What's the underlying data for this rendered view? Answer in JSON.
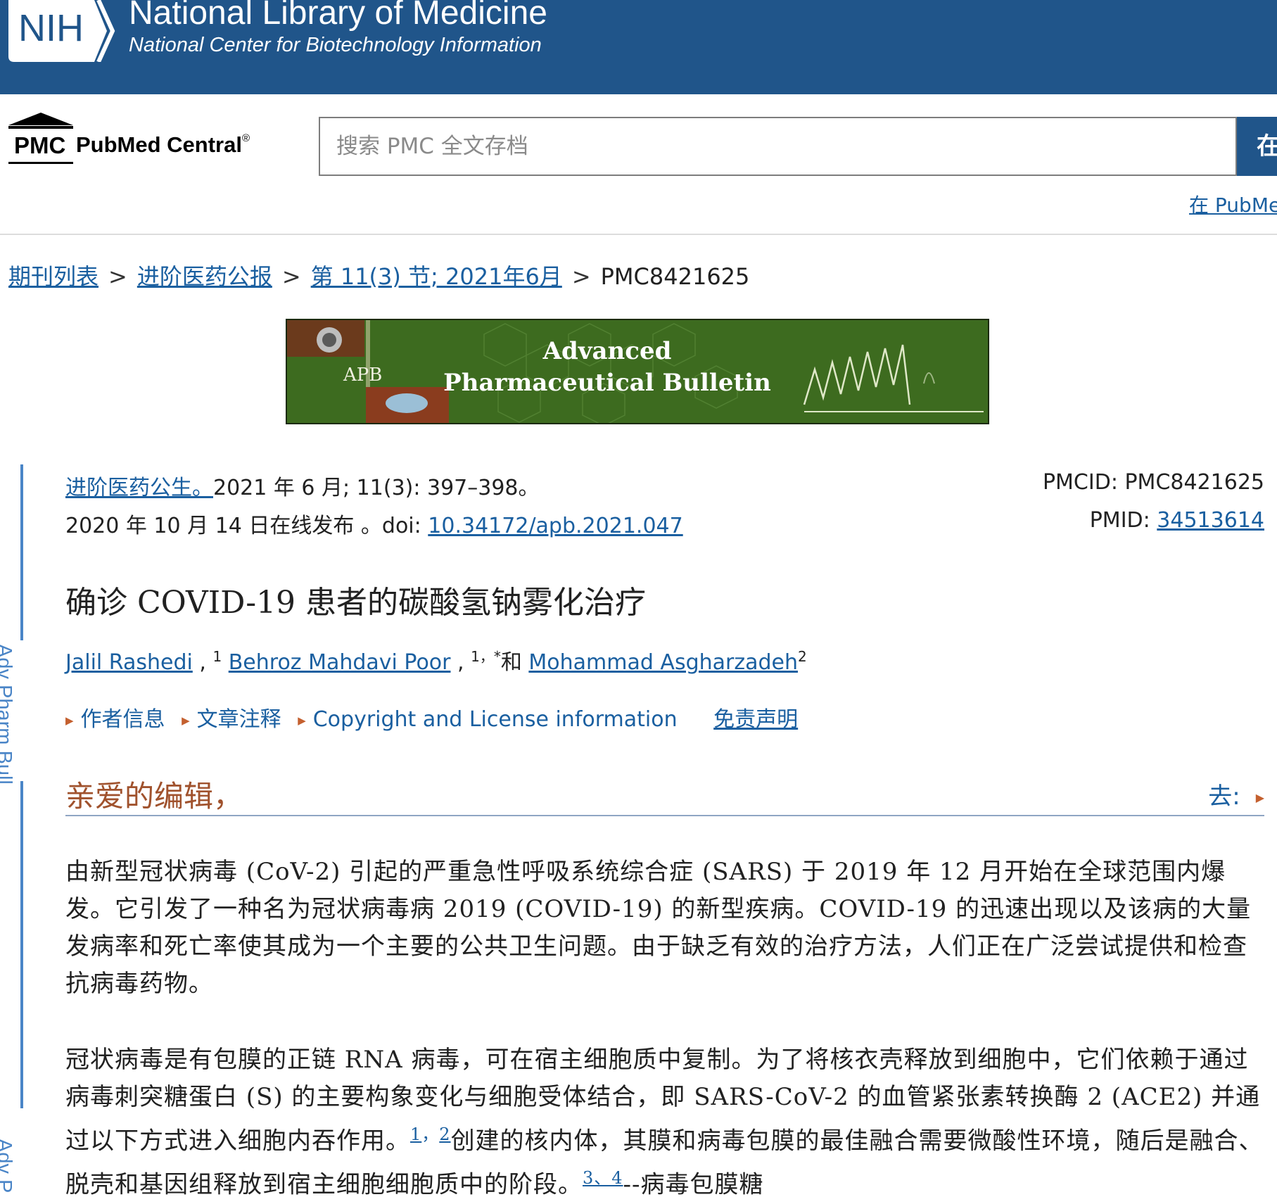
{
  "nih_banner": {
    "logo_text": "NIH",
    "title": "National Library of Medicine",
    "subtitle": "National Center for Biotechnology Information"
  },
  "pmc_header": {
    "logo_abbr": "PMC",
    "logo_name": "PubMed Central",
    "logo_reg": "®",
    "search_placeholder": "搜索 PMC 全文存档",
    "search_button_label": "在",
    "search_pubmed_label": "在 PubMe"
  },
  "breadcrumb": {
    "items": [
      "期刊列表",
      "进阶医药公报",
      "第 11(3) 节;  2021年6月"
    ],
    "separator": ">",
    "current": "PMC8421625"
  },
  "journal_banner": {
    "abbr": "APB",
    "title_line1": "Advanced",
    "title_line2": "Pharmaceutical Bulletin"
  },
  "side_label": {
    "text": "Adv Pharm Bull",
    "text_partial": "Adv P"
  },
  "citation": {
    "journal_link": "进阶医药公生。",
    "details": "2021 年 6 月;  11(3):  397–398。",
    "online": "2020 年 10 月 14 日在线发布 。doi: ",
    "doi": "10.34172/apb.2021.047",
    "pmcid_label": "PMCID:  PMC8421625",
    "pmid_label": "PMID: ",
    "pmid": "34513614"
  },
  "article": {
    "title": "确诊 COVID-19 患者的碳酸氢钠雾化治疗"
  },
  "authors": {
    "a1": "Jalil Rashedi",
    "a1_sup": "1",
    "a2": "Behroz Mahdavi Poor",
    "a2_sup": "1，*",
    "conj": "和",
    "a3": "Mohammad Asgharzadeh",
    "a3_sup": "2",
    "comma": " , "
  },
  "info_links": {
    "author_info": "作者信息",
    "article_notes": "文章注释",
    "copyright": "Copyright and License information",
    "disclaimer": "免责声明"
  },
  "section": {
    "heading": "亲爱的编辑，",
    "goto_label": "去:"
  },
  "body": {
    "para1": "由新型冠状病毒 (CoV-2) 引起的严重急性呼吸系统综合症 (SARS) 于 2019 年 12 月开始在全球范围内爆发。它引发了一种名为冠状病毒病 2019 (COVID-19) 的新型疾病。COVID-19 的迅速出现以及该病的大量发病率和死亡率使其成为一个主要的公共卫生问题。由于缺乏有效的治疗方法，人们正在广泛尝试提供和检查抗病毒药物。",
    "para2_a": "冠状病毒是有包膜的正链 RNA 病毒，可在宿主细胞质中复制。为了将核衣壳释放到细胞中，它们依赖于通过病毒刺突糖蛋白 (S) 的主要构象变化与细胞受体结合，即 SARS-CoV-2 的血管紧张素转换酶 2 (ACE2) 并通过以下方式进入细胞内吞作用。",
    "ref1": "1",
    "ref_sep1": "，",
    "ref2": "2",
    "para2_b": "创建的核内体，其膜和病毒包膜的最佳融合需要微酸性环境，随后是融合、脱壳和基因组释放到宿主细胞细胞质中的阶段。",
    "ref3": "3、4",
    "para2_c": "--病毒包膜糖"
  },
  "colors": {
    "nih_blue": "#20558a",
    "link_blue": "#1a5fa0",
    "heading_brown": "#a0522d",
    "banner_green": "#3c6a1e"
  }
}
